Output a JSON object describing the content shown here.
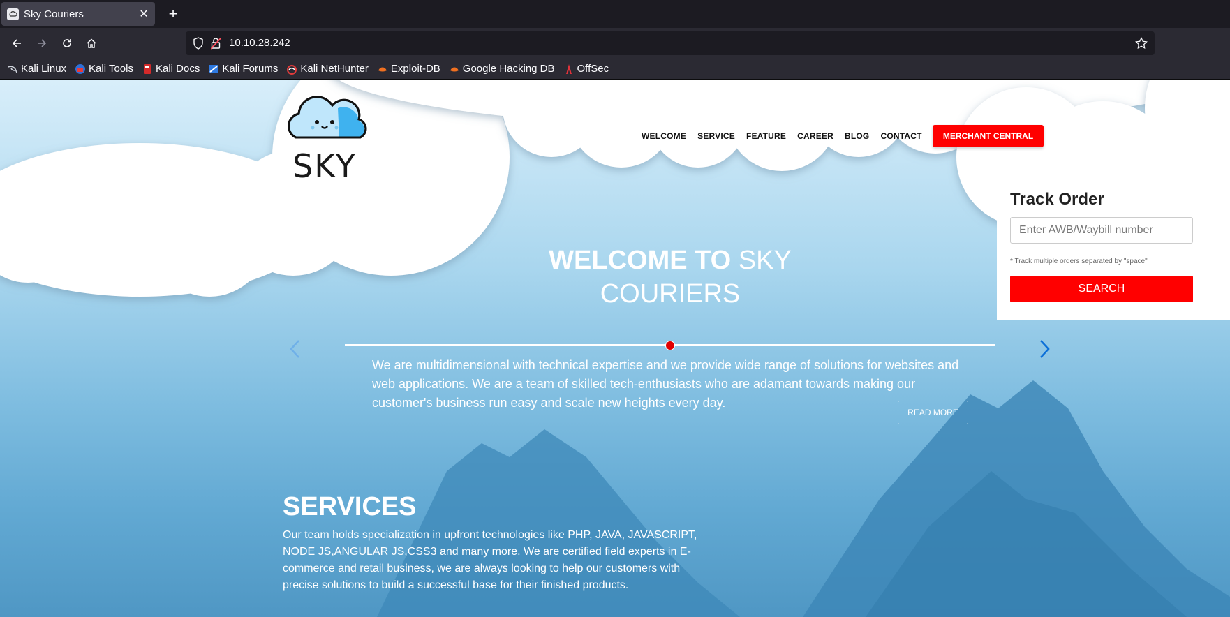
{
  "browser": {
    "tab_title": "Sky Couriers",
    "url": "10.10.28.242",
    "bookmarks": [
      "Kali Linux",
      "Kali Tools",
      "Kali Docs",
      "Kali Forums",
      "Kali NetHunter",
      "Exploit-DB",
      "Google Hacking DB",
      "OffSec"
    ]
  },
  "site": {
    "logo_text": "SKY",
    "nav": [
      "WELCOME",
      "SERVICE",
      "FEATURE",
      "CAREER",
      "BLOG",
      "CONTACT"
    ],
    "merchant_button": "MERCHANT CENTRAL",
    "track": {
      "title": "Track Order",
      "placeholder": "Enter AWB/Waybill number",
      "note": "* Track multiple orders separated by \"space\"",
      "button": "SEARCH"
    },
    "hero": {
      "title_bold": "WELCOME TO",
      "title_light_1": "SKY",
      "title_light_2": "COURIERS",
      "text": "We are multidimensional with technical expertise and we provide wide range of solutions for websites and web applications. We are a team of skilled tech-enthusiasts who are adamant towards making our customer's business run easy and scale new heights every day.",
      "read_more": "READ MORE"
    },
    "services": {
      "title": "SERVICES",
      "text": "Our team holds specialization in upfront technologies like PHP, JAVA, JAVASCRIPT, NODE JS,ANGULAR JS,CSS3 and many more. We are certified field experts in E-commerce and retail business, we are always looking to help our customers with precise solutions to build a successful base for their finished products."
    }
  },
  "colors": {
    "accent_red": "#ff0000",
    "browser_dark": "#1c1b22",
    "toolbar": "#2b2a33"
  }
}
